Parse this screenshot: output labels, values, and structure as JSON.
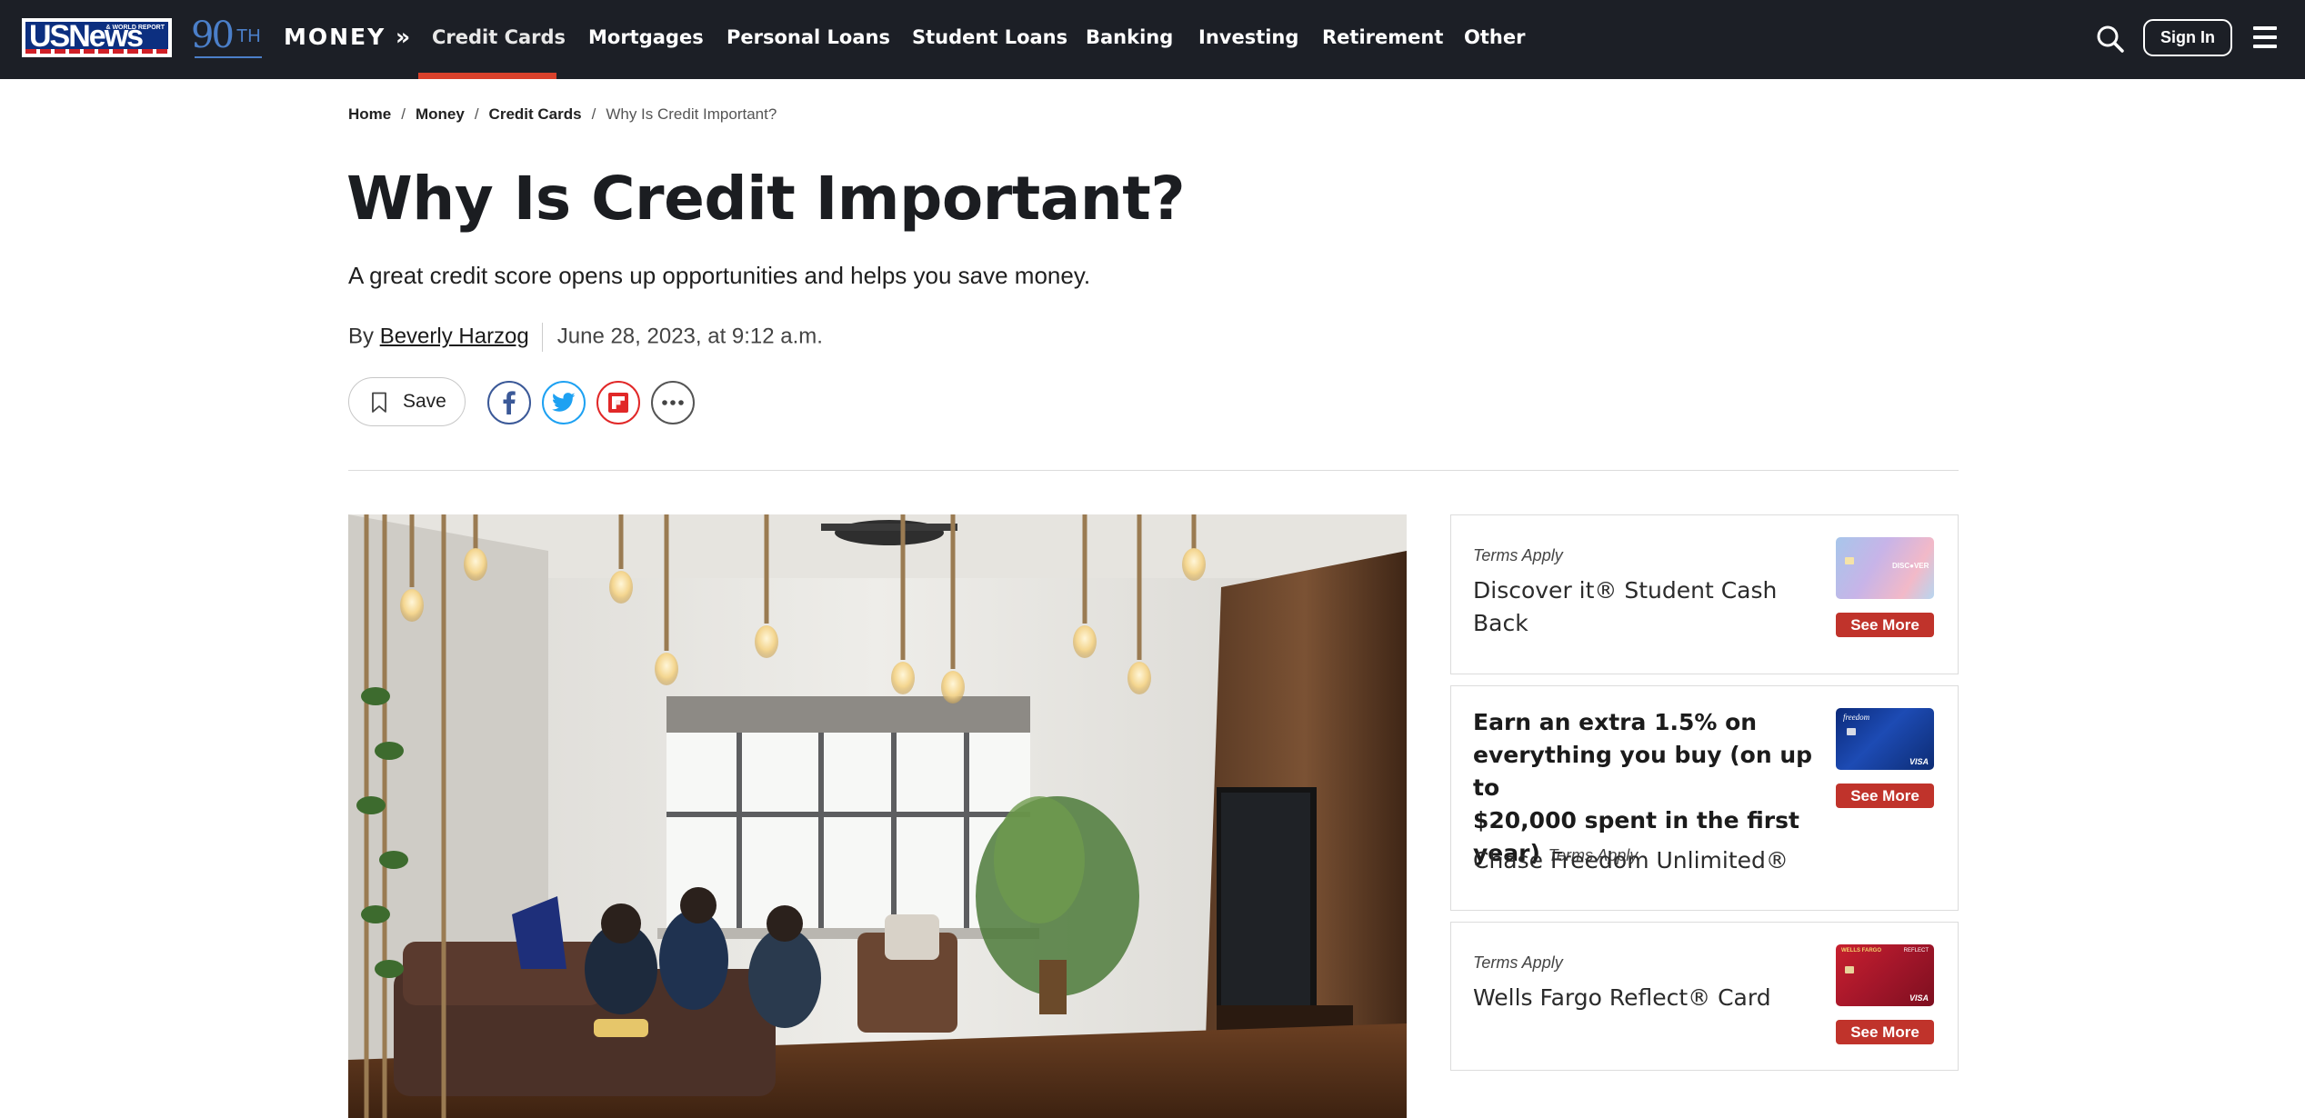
{
  "brand": {
    "logo_text": "USNews",
    "logo_small": "& WORLD REPORT",
    "anniversary_num": "90",
    "anniversary_suffix": "TH"
  },
  "nav": {
    "section_label": "MONEY »",
    "items": [
      {
        "label": "Credit Cards",
        "active": true
      },
      {
        "label": "Mortgages"
      },
      {
        "label": "Personal Loans"
      },
      {
        "label": "Student Loans"
      },
      {
        "label": "Banking"
      },
      {
        "label": "Investing"
      },
      {
        "label": "Retirement"
      },
      {
        "label": "Other"
      }
    ],
    "search_icon": "search-icon",
    "signin_label": "Sign In",
    "menu_icon": "hamburger-menu-icon",
    "accent_color": "#d9412b",
    "bg_color": "#1c1f26"
  },
  "breadcrumb": {
    "items": [
      "Home",
      "Money",
      "Credit Cards"
    ],
    "separator": "/",
    "current": "Why Is Credit Important?"
  },
  "article": {
    "title": "Why Is Credit Important?",
    "dek": "A great credit score opens up opportunities and helps you save money.",
    "by_prefix": "By",
    "author": "Beverly Harzog",
    "date": "June 28, 2023, at 9:12 a.m.",
    "save_label": "Save",
    "share_icons": [
      "facebook-icon",
      "twitter-icon",
      "flipboard-icon",
      "more-icon"
    ]
  },
  "offers": [
    {
      "terms": "Terms Apply",
      "name_line1": "Discover it® Student Cash",
      "name_line2": "Back",
      "card": "Discover",
      "see_more": "See More"
    },
    {
      "promo_lines": [
        "Earn an extra 1.5% on",
        "everything you buy (on up to",
        "$20,000 spent in the first",
        "year)"
      ],
      "terms": "Terms Apply",
      "name": "Chase Freedom Unlimited®",
      "card": "Chase Freedom",
      "see_more": "See More"
    },
    {
      "terms": "Terms Apply",
      "name": "Wells Fargo Reflect® Card",
      "card": "Wells Fargo Reflect",
      "see_more": "See More"
    }
  ],
  "colors": {
    "see_more_button": "#c0332b",
    "facebook": "#3b5998",
    "twitter": "#1da1f2",
    "flipboard": "#e12828"
  }
}
